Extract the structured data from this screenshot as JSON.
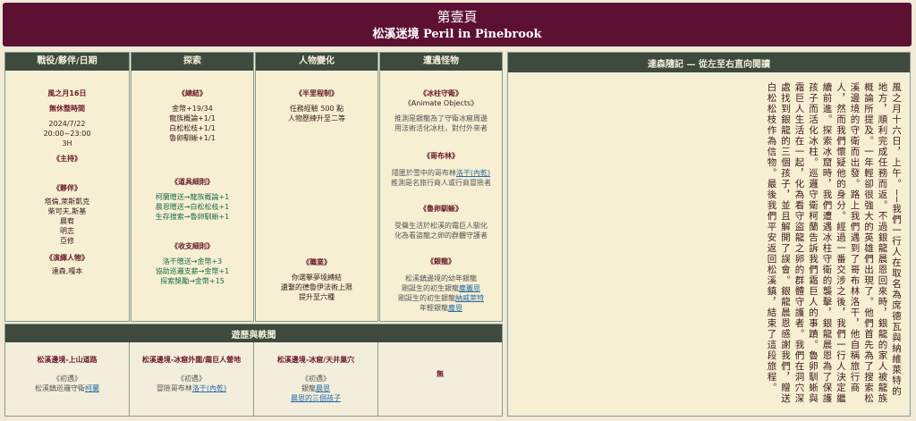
{
  "banner": {
    "line1": "第壹頁",
    "line2": "松溪迷境 Peril in Pinebrook"
  },
  "headers": {
    "date": "戰役/夥伴/日期",
    "explore": "探索",
    "change": "人物變化",
    "monster": "遭遇怪物",
    "journal": "達森隨記 — 從左至右直向閱讀",
    "routes": "遊歷與軼聞"
  },
  "col1": {
    "date": "風之月16日",
    "period": "無休整時間",
    "year": "2024/7/22",
    "time": "20:00~23:00",
    "hours": "3H",
    "host_h": "《主持》",
    "party_h": "《夥伴》",
    "party": [
      "塔倫,萊斯凱克",
      "柴可夫,斯基",
      "晨宥",
      "明志",
      "亞修"
    ],
    "fan_h": "《演繹人物》",
    "fan": "達森,嘎本"
  },
  "col2": {
    "total_h": "《總結》",
    "total": [
      "金幣+19/34",
      "龍族概論+1/1",
      "白松松枝+1/1",
      "魯卵馴蜥+1/1"
    ],
    "gear_h": "《道具細則》",
    "gear": [
      "柯蘭贈送→龍族概論+1",
      "晨恩贈送→白松松枝+1",
      "生存搜索→魯卵馴蜥+1"
    ],
    "income_h": "《收支細則》",
    "income": [
      "洛干贈送→金幣+3",
      "協助巡邏支薪→金幣+1",
      "探索獎勵→金幣+15"
    ]
  },
  "col3": {
    "half_h": "《半里程制》",
    "half": [
      "任務經驗 500 點",
      "人物歷練升至二等"
    ],
    "job_h": "《職業》",
    "job": [
      "你選擊夢境縛結",
      "遺繫的德魯伊法術上限",
      "提升至六種"
    ]
  },
  "col4": {
    "a_h": "《冰柱守衛》",
    "a_sub": "《Animate Objects》",
    "a_txt": [
      "推測是銀龍為了守衛冰窟周邊",
      "用法術活化冰柱，對付外來者"
    ],
    "b_h": "《哥布林》",
    "b_txt1": "隱匿於雪中的哥布林",
    "b_link": "洛干(內乾)",
    "b_txt2": "推測是名旅行商人或行商冒險者",
    "c_h": "《魯卵馴蜥》",
    "c_txt": [
      "受聲生活於松溪的霜巨人馴化",
      "化為看盜龍之卵的群體守護者"
    ],
    "d_h": "《銀龍》",
    "d_txt": [
      "松溪鎮邊境的幼年銀龍",
      "剛誕生的初生銀龍",
      "剛誕生的初生銀龍",
      "年輕銀龍"
    ],
    "d_l1": "塵麗恩",
    "d_l2": "納威萊特",
    "d_l3": "塵恩"
  },
  "routes": [
    {
      "title": "松溪邊境-上山道路",
      "sub": "《初遇》",
      "txt": "松溪鎮巡邏守衛",
      "link": "柯蘭"
    },
    {
      "title": "松溪邊境-冰窟外圍/霜巨人營地",
      "sub": "《初遇》",
      "txt": "冒險哥布林",
      "link": "洛干(內乾)"
    },
    {
      "title": "松溪邊境-冰窟/天井巢穴",
      "sub": "《初遇》",
      "txt": "銀龍",
      "link": "晨恩",
      "link2": "晨恩的三個孩子"
    },
    {
      "title": "無"
    }
  ],
  "journal": "風之月十六日，上午。──我們一行人在取名為席德瓦與納維萊特的地方，順利完成任務而返。不過銀龍晨恩回來時，銀龍的家人被龍族概論所提及。一年輕卻很強大的英雄們出現了。他們首先為了搜索松溪邊境的守衛而出發。路上我們遇到了哥布林洛干，他自稱旅行商人，然而我們懷疑他的身分。經過一番交涉之後，我們一行人決定繼續前進。探索冰窟時，我們遭遇冰柱守衛的襲擊，銀龍晨恩為了保護孩子而活化冰柱。巡邏守衛柯蘭告訴我們霜巨人的事蹟。魯卵馴蜥與霜巨人生活在一起，化為看守盜龍之卵的群體守護者。我們在洞穴深處找到銀龍的三個孩子，並且解開了誤會。銀龍晨恩感謝我們，贈送白松松枝作為信物。最後我們平安返回松溪鎮，結束了這段旅程。"
}
